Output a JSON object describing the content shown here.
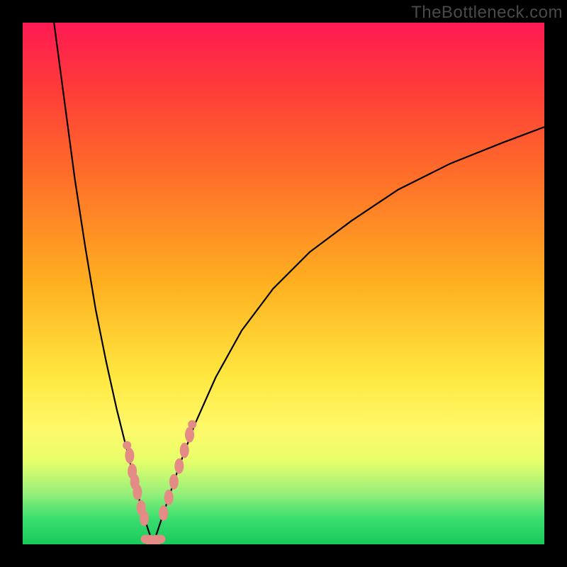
{
  "watermark": "TheBottleneck.com",
  "colors": {
    "frame": "#000000",
    "gradient_top": "#ff1a53",
    "gradient_mid": "#ffe840",
    "gradient_bottom": "#18c95c",
    "curve": "#000000",
    "marker": "#e48b85"
  },
  "chart_data": {
    "type": "line",
    "title": "",
    "xlabel": "",
    "ylabel": "",
    "xlim": [
      0,
      100
    ],
    "ylim": [
      0,
      100
    ],
    "grid": false,
    "legend": false,
    "series": [
      {
        "name": "left-branch",
        "x": [
          6,
          8,
          10,
          12,
          14,
          16,
          18,
          20,
          21,
          22,
          23,
          24,
          25
        ],
        "values": [
          100,
          85,
          70,
          57,
          45,
          35,
          26,
          18,
          14,
          10,
          6,
          3,
          0
        ]
      },
      {
        "name": "right-branch",
        "x": [
          25,
          26,
          28,
          30,
          33,
          37,
          42,
          48,
          55,
          63,
          72,
          82,
          92,
          100
        ],
        "values": [
          0,
          3,
          9,
          15,
          23,
          32,
          41,
          49,
          56,
          62,
          68,
          73,
          77,
          80
        ]
      }
    ],
    "annotations": {
      "markers_description": "salmon circular/pill-shaped markers clustered along lower V near bottom",
      "markers_left_branch": [
        {
          "x": 20.5,
          "y": 17
        },
        {
          "x": 21.0,
          "y": 14
        },
        {
          "x": 21.5,
          "y": 12
        },
        {
          "x": 22.0,
          "y": 10
        },
        {
          "x": 22.7,
          "y": 7
        },
        {
          "x": 23.3,
          "y": 5
        }
      ],
      "markers_right_branch": [
        {
          "x": 27.0,
          "y": 6
        },
        {
          "x": 28.0,
          "y": 9
        },
        {
          "x": 29.0,
          "y": 12
        },
        {
          "x": 30.0,
          "y": 15
        },
        {
          "x": 31.0,
          "y": 18
        },
        {
          "x": 32.0,
          "y": 21
        }
      ],
      "markers_bottom": [
        {
          "x": 24.0,
          "y": 1
        },
        {
          "x": 25.0,
          "y": 0
        },
        {
          "x": 26.0,
          "y": 1
        }
      ]
    }
  }
}
